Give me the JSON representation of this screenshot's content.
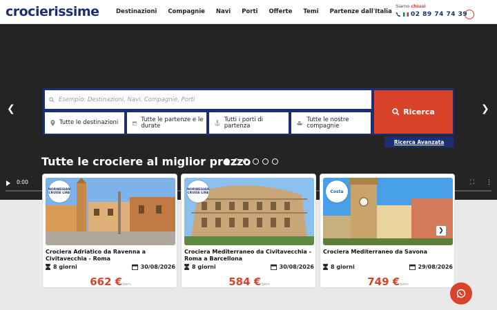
{
  "brand": "crocierissime",
  "nav": [
    "Destinazioni",
    "Compagnie",
    "Navi",
    "Porti",
    "Offerte",
    "Temi",
    "Partenze dall'Italia"
  ],
  "contact": {
    "status_prefix": "Siamo",
    "status": "chiusi",
    "phone": "02 89 74 74 39"
  },
  "search": {
    "placeholder": "Esempio: Destinazioni, Navi, Compagnie, Porti",
    "filters": [
      "Tutte le destinazioni",
      "Tutte le partenze e le durate",
      "Tutti i porti di partenza",
      "Tutte le nostre compagnie"
    ],
    "button": "Ricerca",
    "advanced": "Ricerca Avanzata"
  },
  "section_title": "Tutte le crociere al miglior prezzo",
  "video": {
    "time": "0:00"
  },
  "cards": [
    {
      "line": "NORWEGIAN CRUISE LINE",
      "title": "Crociera Adriatico da Ravenna a Civitavecchia - Roma",
      "duration": "8 giorni",
      "date": "30/08/2026",
      "price": "662 €",
      "unit": "/pers"
    },
    {
      "line": "NORWEGIAN CRUISE LINE",
      "title": "Crociera Mediterraneo da Civitavecchia - Roma a Barcellona",
      "duration": "8 giorni",
      "date": "30/08/2026",
      "price": "584 €",
      "unit": "/pers"
    },
    {
      "line": "Costa",
      "title": "Crociera Mediterraneo da Savona",
      "duration": "8 giorni",
      "date": "29/08/2026",
      "price": "749 €",
      "unit": "/pers"
    }
  ],
  "colors": {
    "brand": "#1c2f73",
    "accent": "#d9432a"
  }
}
